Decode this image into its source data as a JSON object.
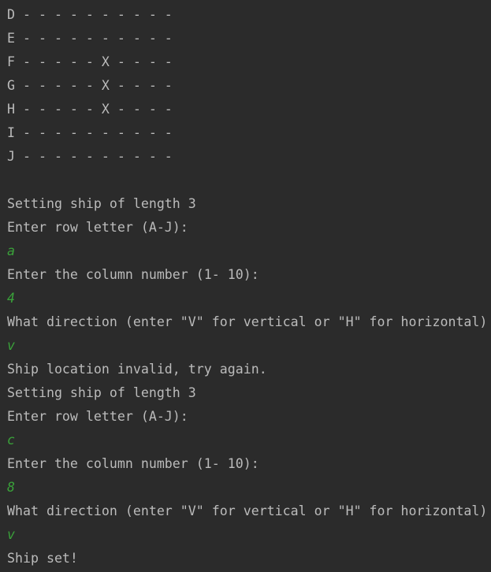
{
  "console": {
    "colors": {
      "background": "#2b2b2b",
      "output_text": "#bbbbbb",
      "user_input_text": "#3aa13a"
    },
    "board_rows": [
      "D - - - - - - - - - -",
      "E - - - - - - - - - -",
      "F - - - - - X - - - -",
      "G - - - - - X - - - -",
      "H - - - - - X - - - -",
      "I - - - - - - - - - -",
      "J - - - - - - - - - -"
    ],
    "lines": [
      {
        "kind": "output",
        "text": "Setting ship of length 3"
      },
      {
        "kind": "output",
        "text": "Enter row letter (A-J):"
      },
      {
        "kind": "input",
        "text": "a"
      },
      {
        "kind": "output",
        "text": "Enter the column number (1- 10):"
      },
      {
        "kind": "input",
        "text": "4"
      },
      {
        "kind": "output",
        "text": "What direction (enter \"V\" for vertical or \"H\" for horizontal)"
      },
      {
        "kind": "input",
        "text": "v"
      },
      {
        "kind": "output",
        "text": "Ship location invalid, try again."
      },
      {
        "kind": "output",
        "text": "Setting ship of length 3"
      },
      {
        "kind": "output",
        "text": "Enter row letter (A-J):"
      },
      {
        "kind": "input",
        "text": "c"
      },
      {
        "kind": "output",
        "text": "Enter the column number (1- 10):"
      },
      {
        "kind": "input",
        "text": "8"
      },
      {
        "kind": "output",
        "text": "What direction (enter \"V\" for vertical or \"H\" for horizontal)"
      },
      {
        "kind": "input",
        "text": "v"
      },
      {
        "kind": "output",
        "text": "Ship set!"
      }
    ]
  }
}
